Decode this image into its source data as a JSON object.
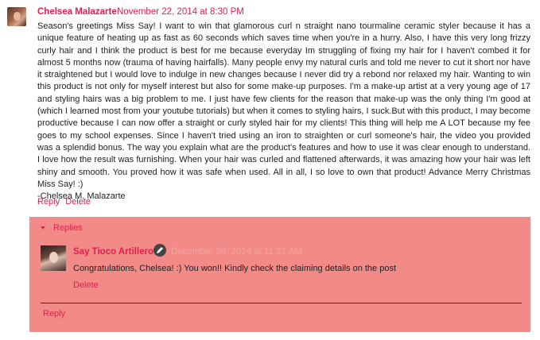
{
  "comment": {
    "author": "Chelsea Malazarte",
    "date": "November 22, 2014 at 8:30 PM",
    "body": "Season's greetings Miss Say! I want to win that glamorous curl n straight nano tourmaline ceramic styler because it has a unique feature of heating up as fast as 60 seconds which saves time when you're in a hurry. Also, I have this very long frizzy curly hair and I think the product is best for me because everyday Im struggling of fixing my hair for I haven't combed it for almost 5 months now (trauma of having hairfalls). Many people envy my natural curls and told me never to cut it short nor have it straightened but I would love to indulge in new changes because I never did try a rebond nor relaxed my hair. Wanting to win this product is not only for myself interest but also for some make-up purposes. I'm a make-up artist at a very young age of 17 and styling hairs was a big problem to me. I just have few clients for the reason that make-up was the only thing I'm good at (which I learned most from your youtube tutorials) but when it comes to styling hairs, I suck.But with this product, I may become productive because I can now offer a straight or curly styled hair for my clients! This thing will help me A LOT because my fee goes to my school expenses. Since I haven't tried using an iron to straighten or curl someone's hair, the video you provided was a splendid bonus. The way you explain what are the product's features and how to use it was clear enough to understand. I love how the result was furnishing. When your hair was curled and flattened afterwards, it was amazing how your hair was left shiny and smooth. You proved how it was safe when used. All in all, I so love to own that product! Advance Merry Christmas Miss Say! :)",
    "signature": "-Chelsea M. Malazarte",
    "actions": {
      "reply": "Reply",
      "delete": "Delete"
    }
  },
  "replies": {
    "toggle_label": "Replies",
    "items": [
      {
        "author": "Say Tioco Artillero",
        "date": "December 30, 2014 at 11:31 AM",
        "text": "Congratulations, Chelsea! :) You won!! Kindly check the claiming details on the post",
        "delete": "Delete"
      }
    ],
    "reply_link": "Reply"
  },
  "colors": {
    "accent": "#e0204f",
    "replies_background": "#f28a87"
  }
}
